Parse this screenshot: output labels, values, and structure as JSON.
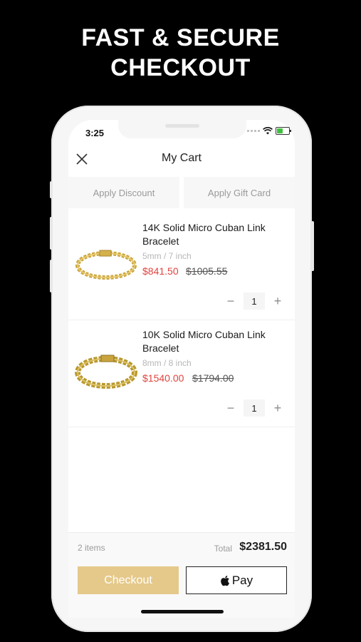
{
  "headline": {
    "line1": "FAST & SECURE",
    "line2": "CHECKOUT"
  },
  "status_bar": {
    "time": "3:25"
  },
  "nav": {
    "title": "My Cart"
  },
  "apply": {
    "discount_label": "Apply Discount",
    "gift_card_label": "Apply Gift Card"
  },
  "cart_items": [
    {
      "name": "14K Solid Micro Cuban Link Bracelet",
      "variant": "5mm / 7 inch",
      "price": "$841.50",
      "old_price": "$1005.55",
      "quantity": "1"
    },
    {
      "name": "10K Solid Micro Cuban Link Bracelet",
      "variant": "8mm / 8 inch",
      "price": "$1540.00",
      "old_price": "$1794.00",
      "quantity": "1"
    }
  ],
  "summary": {
    "items_count": "2 items",
    "total_label": "Total",
    "total": "$2381.50"
  },
  "actions": {
    "checkout_label": "Checkout",
    "apple_pay_label": "Pay"
  },
  "qty_controls": {
    "minus": "−",
    "plus": "+"
  },
  "colors": {
    "sale_price": "#e0443e",
    "checkout_bg": "#e5c98a",
    "gold": "#c9a43e"
  }
}
